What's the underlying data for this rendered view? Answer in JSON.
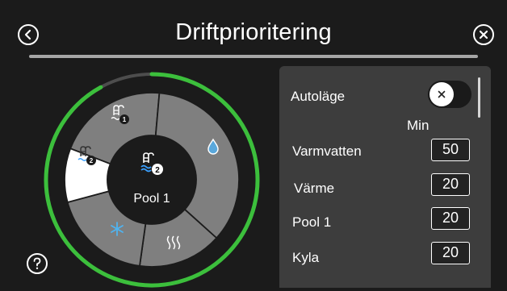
{
  "header": {
    "title": "Driftprioritering"
  },
  "wheel": {
    "center_label": "Pool 1",
    "progress_fraction": 0.92,
    "segments": [
      {
        "name": "pool-1-segment",
        "icon": "pool-1-icon"
      },
      {
        "name": "hot-water-segment",
        "icon": "water-drop-icon"
      },
      {
        "name": "heating-segment",
        "icon": "heating-icon"
      },
      {
        "name": "cooling-segment",
        "icon": "snowflake-icon"
      },
      {
        "name": "pool-2-segment",
        "icon": "pool-2-icon",
        "selected": true
      }
    ],
    "icon_badges": {
      "pool1": "1",
      "pool2": "2"
    },
    "colors": {
      "segment": "#7f7f7f",
      "selected_segment": "#ffffff",
      "center": "#1b1b1b",
      "progress": "#3cbf3c",
      "track": "#4d4d4d"
    }
  },
  "settings": {
    "autolage_label": "Autoläge",
    "autolage_enabled": false,
    "unit_label": "Min",
    "rows": [
      {
        "label": "Varmvatten",
        "value": "50"
      },
      {
        "label": "Värme",
        "value": "20"
      },
      {
        "label": "Pool 1",
        "value": "20"
      },
      {
        "label": "Kyla",
        "value": "20"
      }
    ]
  },
  "icons": {
    "back": "back-icon",
    "close": "close-icon",
    "help": "help-icon"
  },
  "colors": {
    "background": "#1b1b1b",
    "panel": "#3d3d3d",
    "accent_green": "#3cbf3c"
  }
}
